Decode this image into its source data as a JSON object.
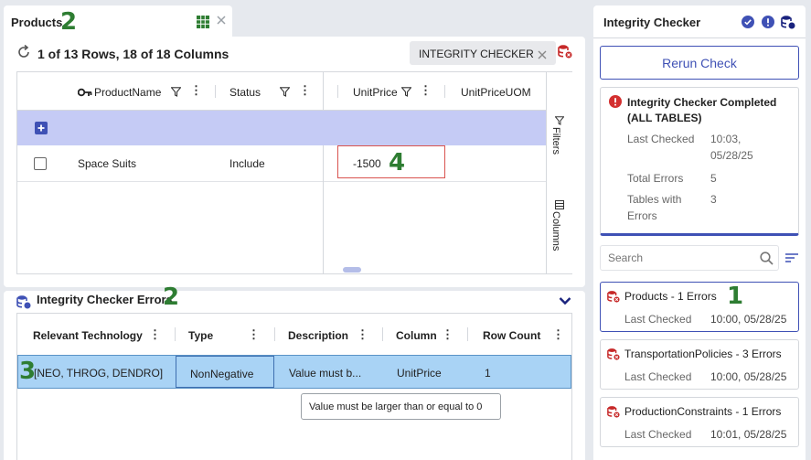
{
  "products_tab": {
    "title": "Products",
    "marker": "2"
  },
  "grid": {
    "rows_summary": "1 of 13 Rows, 18 of 18 Columns",
    "chip_label": "INTEGRITY CHECKER",
    "columns": [
      "ProductName",
      "Status",
      "UnitPrice",
      "UnitPriceUOM"
    ],
    "row": {
      "product_name": "Space Suits",
      "status": "Include",
      "unit_price": "-1500"
    },
    "unit_price_marker": "4",
    "side_filters": "Filters",
    "side_columns": "Columns"
  },
  "errors_panel": {
    "title": "Integrity Checker Errors",
    "marker": "2",
    "columns": [
      "Relevant Technology",
      "Type",
      "Description",
      "Column",
      "Row Count"
    ],
    "row": {
      "relevant_technology": "[NEO, THROG, DENDRO]",
      "type": "NonNegative",
      "description": "Value must b...",
      "column": "UnitPrice",
      "row_count": "1"
    },
    "row_marker": "3",
    "tooltip": "Value must be larger than or equal to 0"
  },
  "integrity_checker": {
    "title": "Integrity Checker",
    "rerun_label": "Rerun Check",
    "status_title": "Integrity Checker Completed (ALL TABLES)",
    "last_checked_label": "Last Checked",
    "last_checked_value": "10:03, 05/28/25",
    "total_errors_label": "Total Errors",
    "total_errors_value": "5",
    "tables_with_errors_label": "Tables with Errors",
    "tables_with_errors_value": "3",
    "search_placeholder": "Search",
    "results": [
      {
        "name": "Products - 1 Errors",
        "last_checked": "10:00, 05/28/25"
      },
      {
        "name": "TransportationPolicies - 3 Errors",
        "last_checked": "10:00, 05/28/25"
      },
      {
        "name": "ProductionConstraints - 1 Errors",
        "last_checked": "10:01, 05/28/25"
      }
    ],
    "results_marker": "1"
  },
  "colors": {
    "accent": "#3f51b5",
    "selected_row": "#a9d3f5",
    "error_red": "#d32f2f",
    "marker_green": "#2e7d32",
    "header_band": "#c5cbf5"
  },
  "icons": [
    "grid-icon",
    "close-icon",
    "refresh-icon",
    "database-icon",
    "key-icon",
    "filter-icon",
    "kebab-icon",
    "plus-icon",
    "chevron-down-icon",
    "check-circle-icon",
    "alert-circle-icon",
    "search-icon",
    "sort-icon"
  ]
}
